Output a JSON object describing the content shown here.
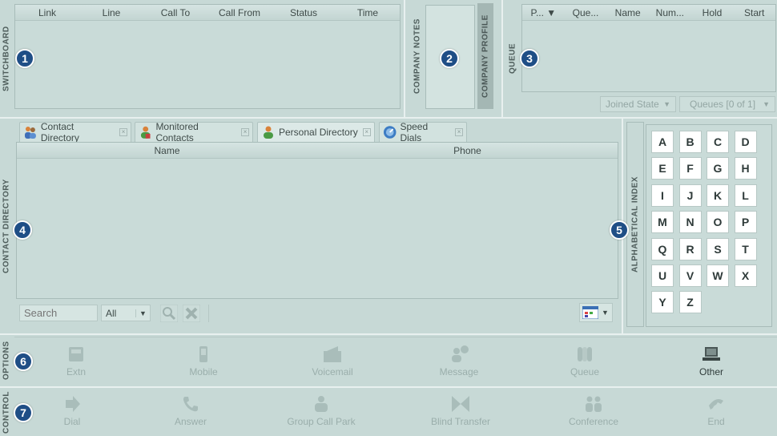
{
  "sections": {
    "switchboard": "SWITCHBOARD",
    "company_notes": "COMPANY NOTES",
    "company_profile": "COMPANY PROFILE",
    "queue": "QUEUE",
    "contact_directory": "CONTACT DIRECTORY",
    "alphabetical_index": "ALPHABETICAL INDEX",
    "options": "OPTIONS",
    "control": "CONTROL"
  },
  "badges": [
    "1",
    "2",
    "3",
    "4",
    "5",
    "6",
    "7"
  ],
  "switchboard": {
    "columns": [
      "Link",
      "Line",
      "Call To",
      "Call From",
      "Status",
      "Time"
    ]
  },
  "queue": {
    "columns": [
      "P...",
      "Que...",
      "Name",
      "Num...",
      "Hold",
      "Start"
    ],
    "joined_state": "Joined State",
    "queues": "Queues [0 of 1]"
  },
  "contact_tabs": [
    {
      "label": "Contact Directory",
      "icon": "contact-directory-icon"
    },
    {
      "label": "Monitored Contacts",
      "icon": "monitored-contacts-icon"
    },
    {
      "label": "Personal Directory",
      "icon": "personal-directory-icon"
    },
    {
      "label": "Speed Dials",
      "icon": "speed-dials-icon"
    }
  ],
  "contact_table": {
    "columns": [
      "Name",
      "Phone"
    ]
  },
  "search": {
    "placeholder": "Search",
    "filter": "All"
  },
  "letters": [
    "A",
    "B",
    "C",
    "D",
    "E",
    "F",
    "G",
    "H",
    "I",
    "J",
    "K",
    "L",
    "M",
    "N",
    "O",
    "P",
    "Q",
    "R",
    "S",
    "T",
    "U",
    "V",
    "W",
    "X",
    "Y",
    "Z"
  ],
  "options": [
    {
      "label": "Extn",
      "icon": "extension-icon"
    },
    {
      "label": "Mobile",
      "icon": "mobile-icon"
    },
    {
      "label": "Voicemail",
      "icon": "voicemail-icon"
    },
    {
      "label": "Message",
      "icon": "message-icon"
    },
    {
      "label": "Queue",
      "icon": "queue-icon"
    },
    {
      "label": "Other",
      "icon": "other-icon"
    }
  ],
  "controls": [
    {
      "label": "Dial",
      "icon": "dial-icon"
    },
    {
      "label": "Answer",
      "icon": "answer-icon"
    },
    {
      "label": "Group Call Park",
      "icon": "group-call-park-icon"
    },
    {
      "label": "Blind Transfer",
      "icon": "blind-transfer-icon"
    },
    {
      "label": "Conference",
      "icon": "conference-icon"
    },
    {
      "label": "End",
      "icon": "end-icon"
    }
  ],
  "colors": {
    "background": "#c7d9d6",
    "badge": "#1f4e86",
    "disabled_text": "#9aaeab"
  }
}
